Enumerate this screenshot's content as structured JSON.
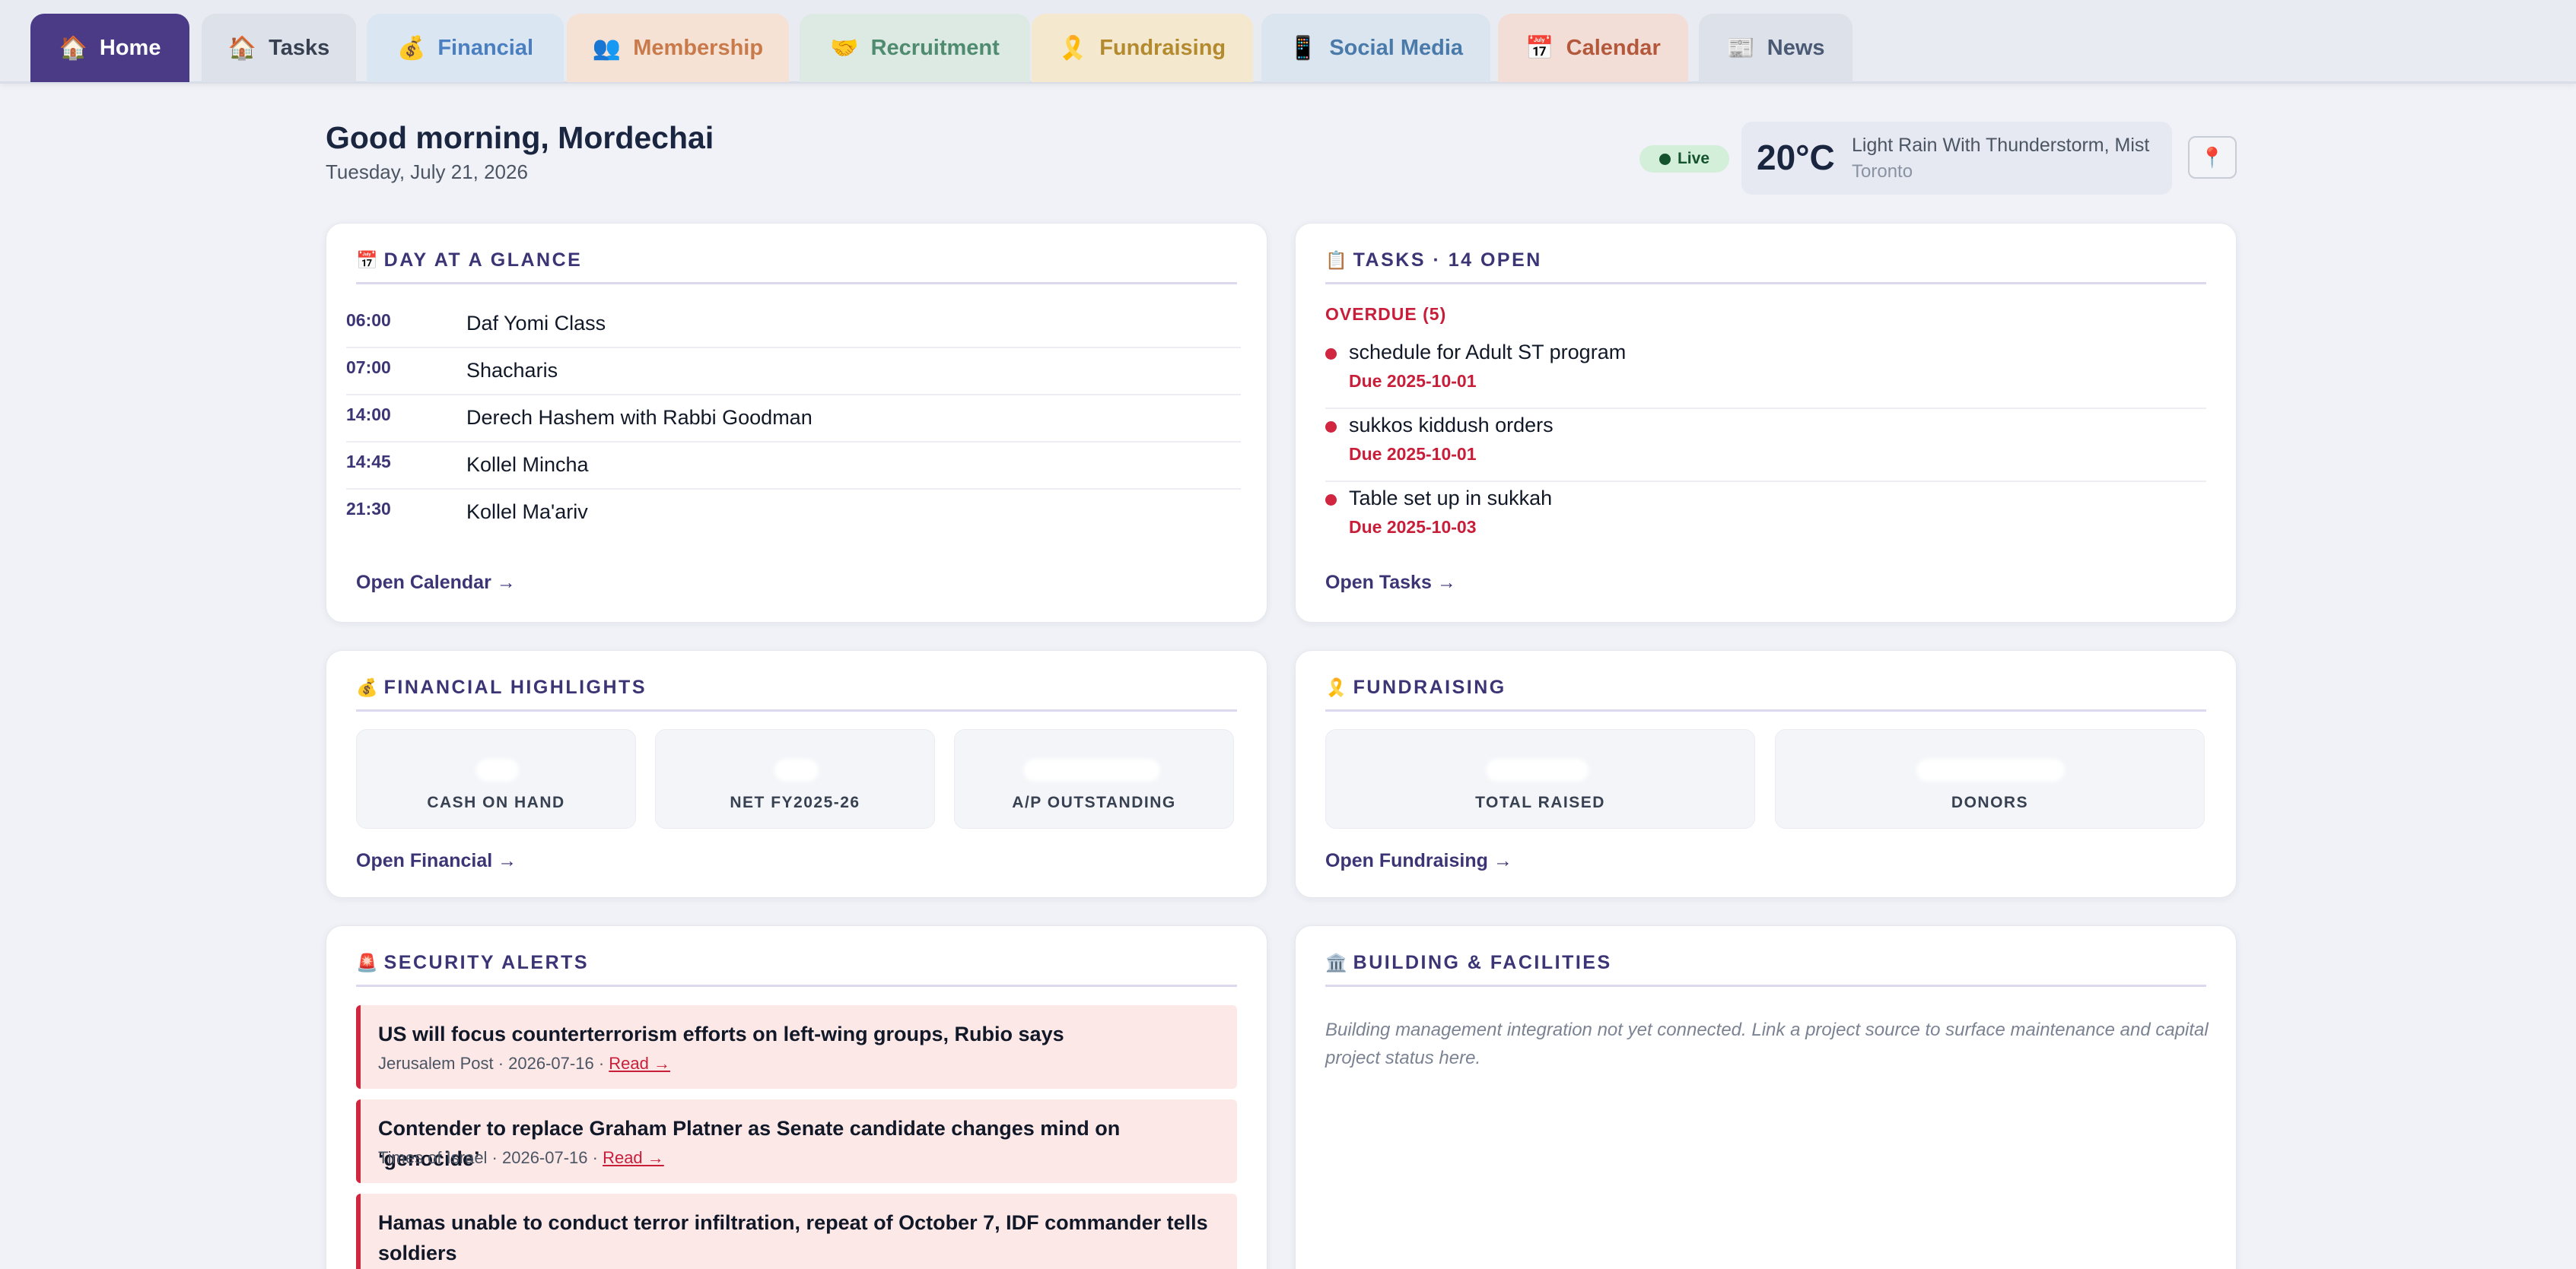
{
  "tabs": [
    {
      "icon": "🏠",
      "label": "Home"
    },
    {
      "icon": "🏠",
      "label": "Tasks"
    },
    {
      "icon": "💰",
      "label": "Financial"
    },
    {
      "icon": "👥",
      "label": "Membership"
    },
    {
      "icon": "🤝",
      "label": "Recruitment"
    },
    {
      "icon": "🎗️",
      "label": "Fundraising"
    },
    {
      "icon": "📱",
      "label": "Social Media"
    },
    {
      "icon": "📅",
      "label": "Calendar"
    },
    {
      "icon": "📰",
      "label": "News"
    }
  ],
  "header": {
    "greeting": "Good morning, Mordechai",
    "date": "Tuesday, July 21, 2026",
    "live_label": "Live",
    "weather": {
      "temp": "20°C",
      "condition": "Light Rain With Thunderstorm, Mist",
      "city": "Toronto"
    },
    "pin_icon": "📍"
  },
  "day": {
    "icon": "📅",
    "title": "DAY AT A GLANCE",
    "events": [
      {
        "time": "06:00",
        "name": "Daf Yomi Class"
      },
      {
        "time": "07:00",
        "name": "Shacharis"
      },
      {
        "time": "14:00",
        "name": "Derech Hashem with Rabbi Goodman"
      },
      {
        "time": "14:45",
        "name": "Kollel Mincha"
      },
      {
        "time": "21:30",
        "name": "Kollel Ma'ariv"
      }
    ],
    "link": "Open Calendar →"
  },
  "tasks": {
    "icon": "📋",
    "title": "TASKS · 14 OPEN",
    "overdue_label": "OVERDUE (5)",
    "items": [
      {
        "name": "schedule for Adult ST program",
        "due": "Due 2025-10-01"
      },
      {
        "name": "sukkos kiddush orders",
        "due": "Due 2025-10-01"
      },
      {
        "name": "Table set up in sukkah",
        "due": "Due 2025-10-03"
      }
    ],
    "link": "Open Tasks →"
  },
  "financial": {
    "icon": "💰",
    "title": "FINANCIAL HIGHLIGHTS",
    "kpis": [
      {
        "label": "CASH ON HAND"
      },
      {
        "label": "NET FY2025-26"
      },
      {
        "label": "A/P OUTSTANDING"
      }
    ],
    "link": "Open Financial →"
  },
  "fundraising": {
    "icon": "🎗️",
    "title": "FUNDRAISING",
    "kpis": [
      {
        "label": "TOTAL RAISED"
      },
      {
        "label": "DONORS"
      }
    ],
    "link": "Open Fundraising →"
  },
  "security": {
    "icon": "🚨",
    "title": "SECURITY ALERTS",
    "alerts": [
      {
        "title": "US will focus counterterrorism efforts on left-wing groups, Rubio says",
        "meta": "Jerusalem Post · 2026-07-16 · ",
        "read": "Read →"
      },
      {
        "title": "Contender to replace Graham Platner as Senate candidate changes mind on ‘genocide’",
        "meta": "Times of Israel · 2026-07-16 · ",
        "read": "Read →"
      },
      {
        "title": "Hamas unable to conduct terror infiltration, repeat of October 7, IDF commander tells soldiers",
        "meta": "",
        "read": ""
      }
    ]
  },
  "building": {
    "icon": "🏛️",
    "title": "BUILDING & FACILITIES",
    "text": "Building management integration not yet connected. Link a project source to surface maintenance and capital project status here."
  }
}
